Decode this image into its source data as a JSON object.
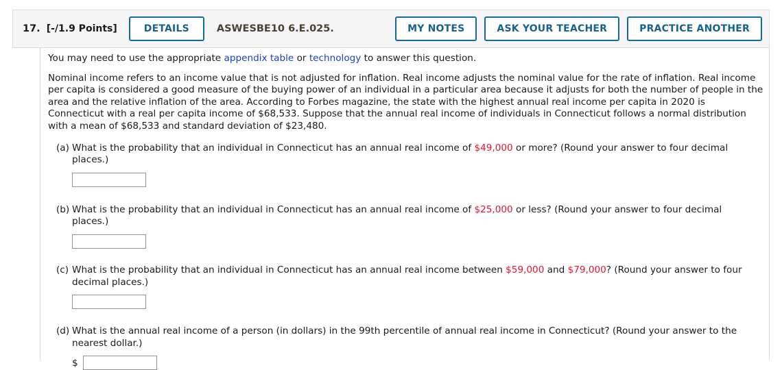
{
  "header": {
    "question_number": "17.",
    "points": "[-/1.9 Points]",
    "details_label": "DETAILS",
    "question_code": "ASWESBE10 6.E.025.",
    "my_notes_label": "MY NOTES",
    "ask_teacher_label": "ASK YOUR TEACHER",
    "practice_another_label": "PRACTICE ANOTHER"
  },
  "lead": {
    "before_link1": "You may need to use the appropriate ",
    "link1": "appendix table",
    "between_links": " or ",
    "link2": "technology",
    "after_link2": " to answer this question."
  },
  "problem": {
    "text": "Nominal income refers to an income value that is not adjusted for inflation. Real income adjusts the nominal value for the rate of inflation. Real income per capita is considered a good measure of the buying power of an individual in a particular area because it adjusts for both the number of people in the area and the relative inflation of the area. According to Forbes magazine, the state with the highest annual real income per capita in 2020 is Connecticut with a real per capita income of $68,533. Suppose that the annual real income of individuals in Connecticut follows a normal distribution with a mean of $68,533 and standard deviation of $23,480."
  },
  "parts": {
    "a": {
      "label": "(a)",
      "text_1": "What is the probability that an individual in Connecticut has an annual real income of ",
      "value_1": "$49,000",
      "text_2": " or more? (Round your answer to four decimal places.)",
      "input_value": "",
      "prefix": ""
    },
    "b": {
      "label": "(b)",
      "text_1": "What is the probability that an individual in Connecticut has an annual real income of ",
      "value_1": "$25,000",
      "text_2": " or less? (Round your answer to four decimal places.)",
      "input_value": "",
      "prefix": ""
    },
    "c": {
      "label": "(c)",
      "text_1": "What is the probability that an individual in Connecticut has an annual real income between ",
      "value_1": "$59,000",
      "text_2": " and ",
      "value_2": "$79,000",
      "text_3": "? (Round your answer to four decimal places.)",
      "input_value": "",
      "prefix": ""
    },
    "d": {
      "label": "(d)",
      "text_1": "What is the annual real income of a person (in dollars) in the 99th percentile of annual real income in Connecticut? (Round your answer to the nearest dollar.)",
      "input_value": "",
      "prefix": "$"
    }
  },
  "colors": {
    "link": "#1a3fd0",
    "highlight": "#e8112d",
    "button_border": "#16699e",
    "button_text": "#19628f",
    "header_bg": "#f5f5f5"
  }
}
